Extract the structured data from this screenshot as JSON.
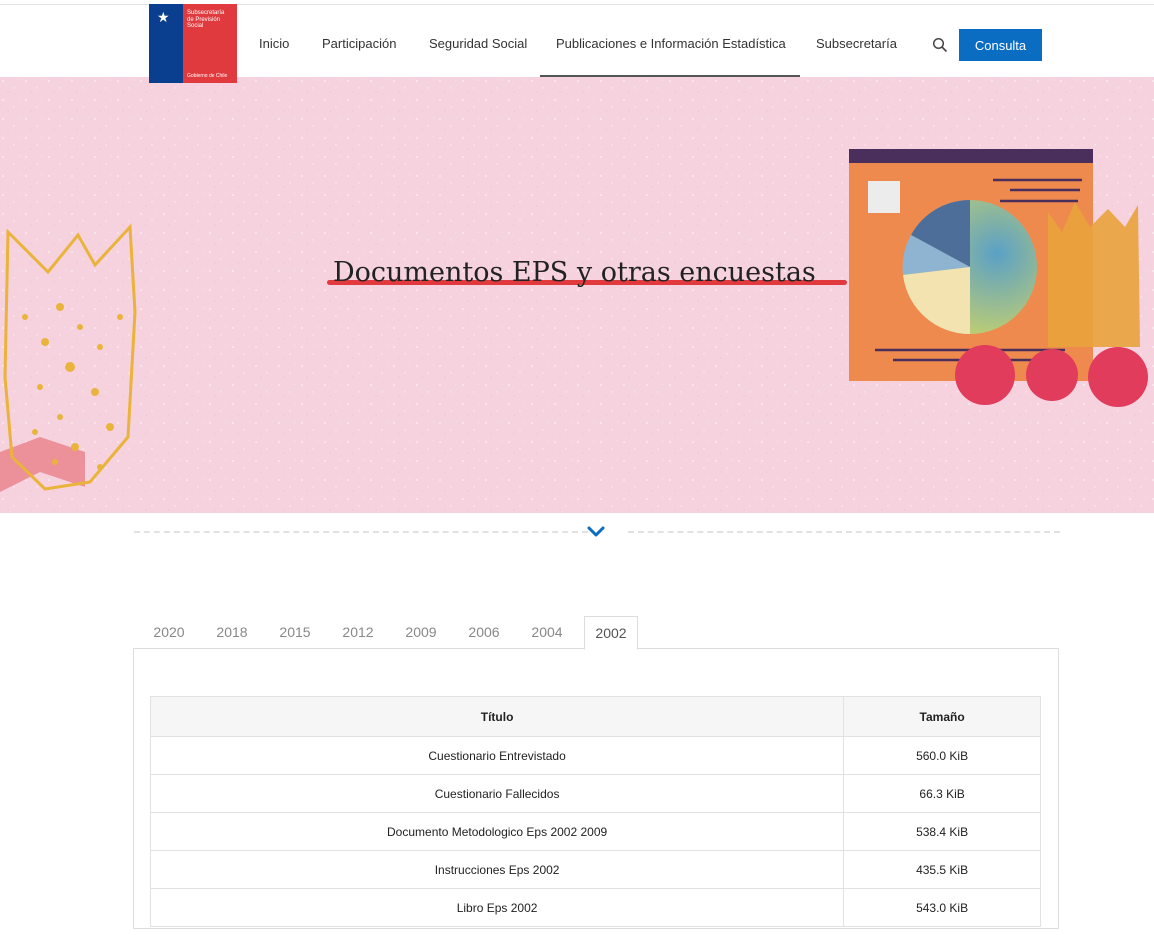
{
  "header": {
    "logo": {
      "org_line1": "Subsecretaría",
      "org_line2": "de Previsión",
      "org_line3": "Social",
      "government": "Gobierno de Chile"
    },
    "nav": [
      "Inicio",
      "Participación",
      "Seguridad Social",
      "Publicaciones e Información Estadística",
      "Subsecretaría"
    ],
    "active_nav": "Publicaciones e Información Estadística",
    "consulta_label": "Consulta"
  },
  "hero": {
    "title": "Documentos EPS y otras encuestas",
    "background_color": "#f5d2de",
    "accent_color": "#e03a3e"
  },
  "tabs": {
    "years": [
      "2020",
      "2018",
      "2015",
      "2012",
      "2009",
      "2006",
      "2004",
      "2002"
    ],
    "active": "2002"
  },
  "table": {
    "headers": [
      "Título",
      "Tamaño"
    ],
    "rows": [
      {
        "title": "Cuestionario Entrevistado",
        "size": "560.0 KiB"
      },
      {
        "title": "Cuestionario Fallecidos",
        "size": "66.3 KiB"
      },
      {
        "title": "Documento Metodologico Eps 2002 2009",
        "size": "538.4 KiB"
      },
      {
        "title": "Instrucciones Eps 2002",
        "size": "435.5 KiB"
      },
      {
        "title": "Libro Eps 2002",
        "size": "543.0 KiB"
      }
    ]
  },
  "icons": [
    "search-icon",
    "chevron-down-icon",
    "star-icon"
  ],
  "colors": {
    "primary_button": "#0a6dc2",
    "logo_blue": "#0a3e8f",
    "logo_red": "#e03a3e"
  }
}
